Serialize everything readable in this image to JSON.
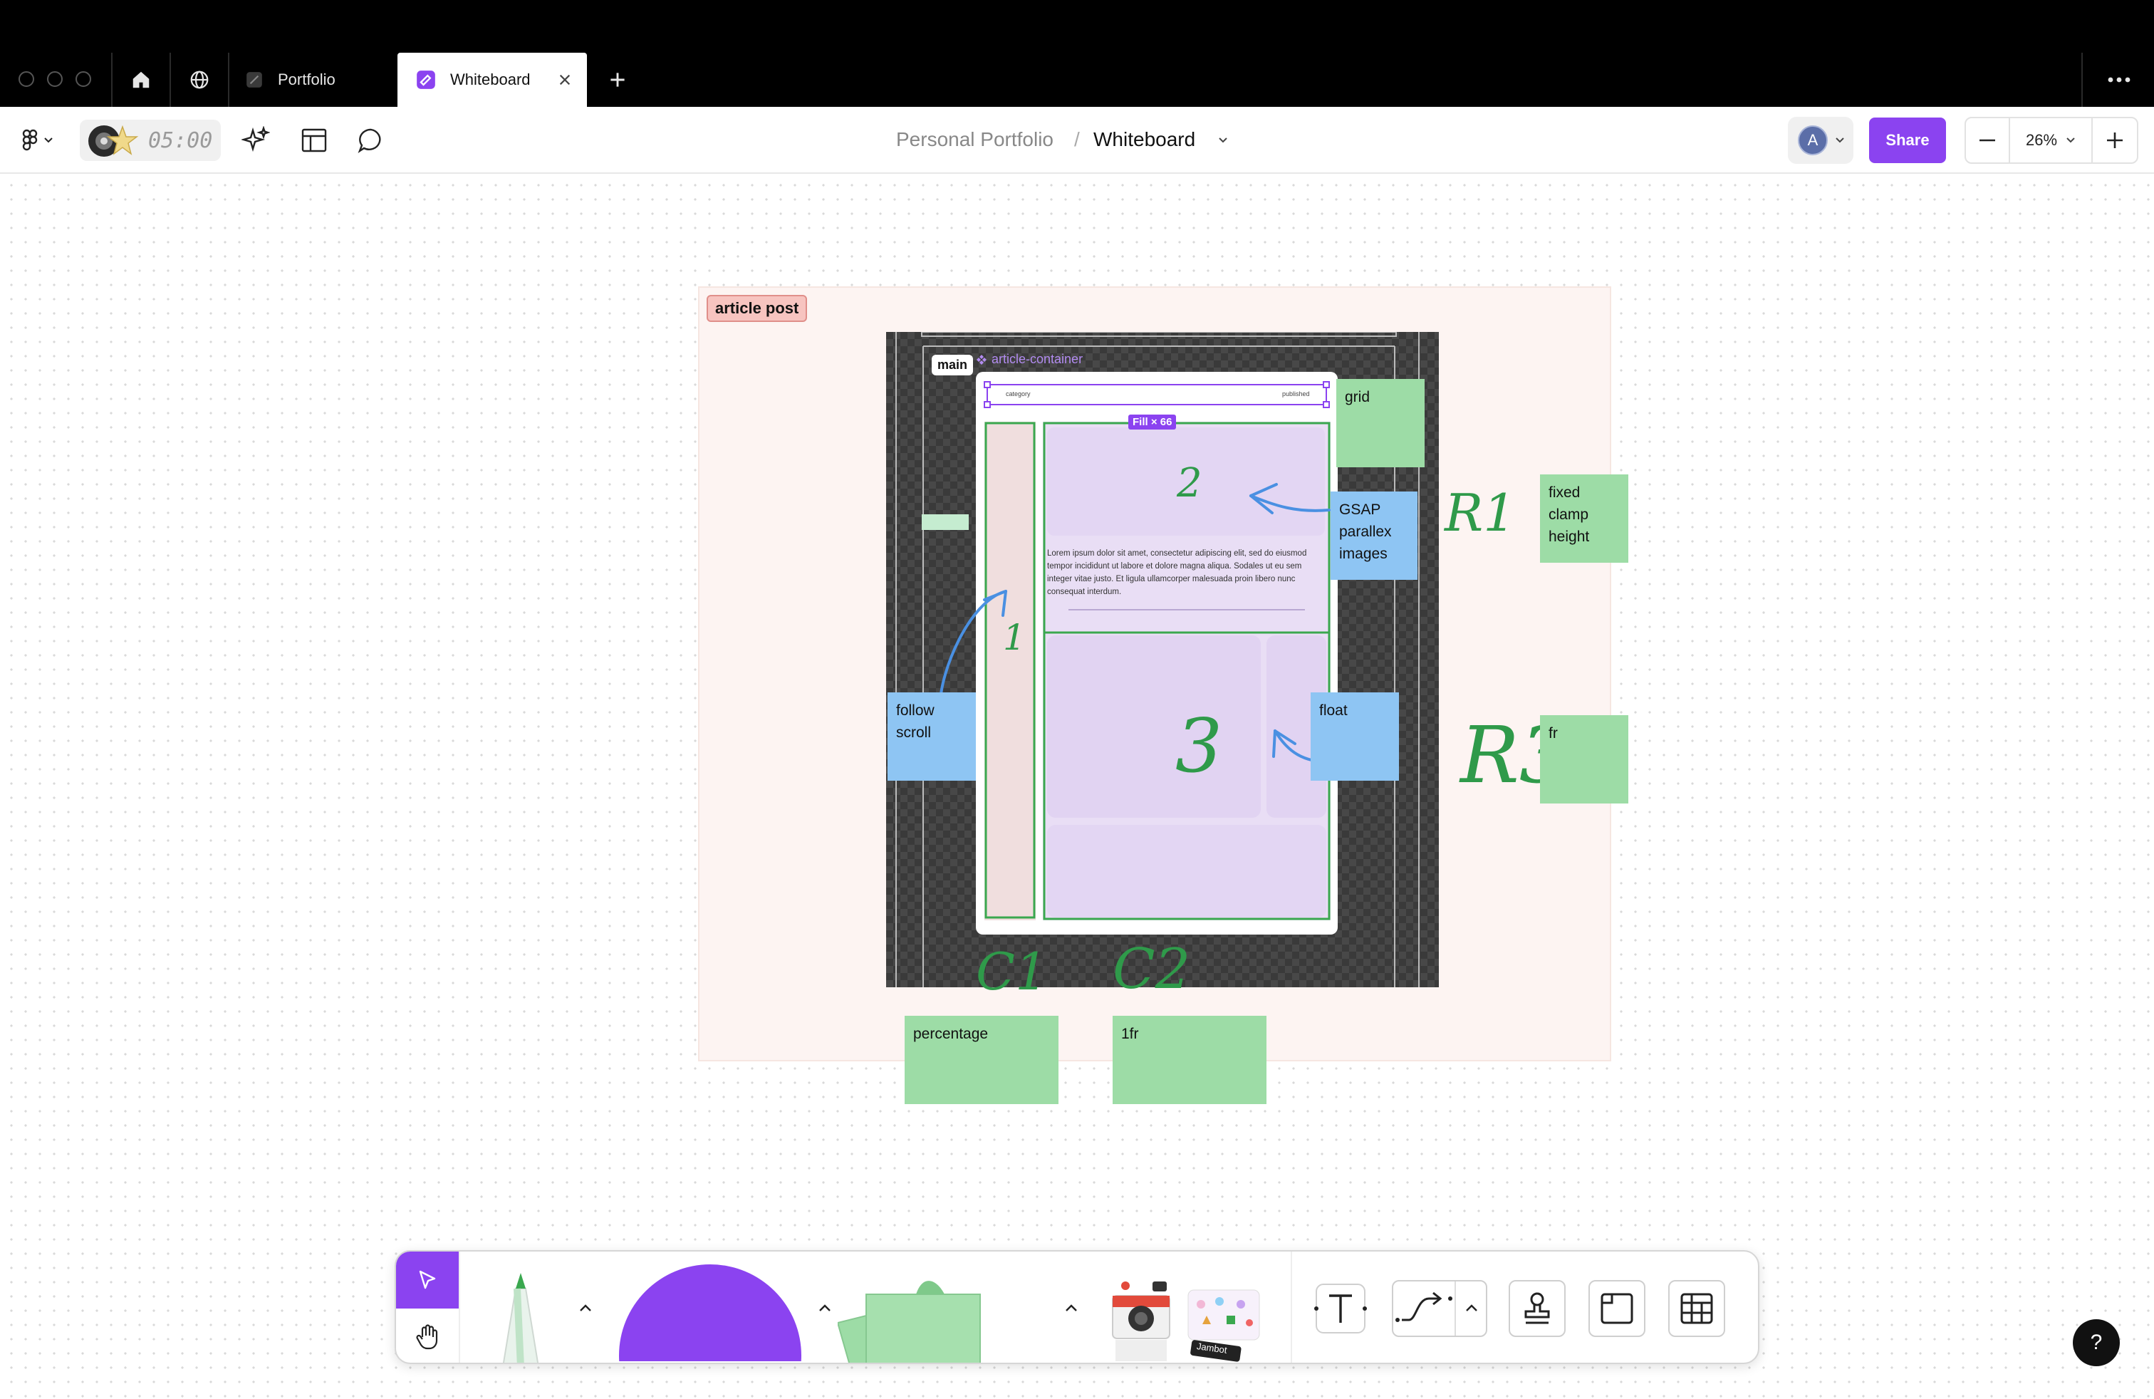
{
  "tabs": [
    {
      "label": "Portfolio"
    },
    {
      "label": "Whiteboard"
    }
  ],
  "toolbar": {
    "timer": "05:00",
    "breadcrumb": {
      "project": "Personal Portfolio",
      "separator": "/",
      "file": "Whiteboard"
    },
    "avatar": "A",
    "share_label": "Share",
    "zoom": "26%"
  },
  "canvas": {
    "section_label": "article post",
    "frame": {
      "main_tag": "main",
      "component_label": "article-container",
      "header_left": "category",
      "header_right": "published",
      "fill_badge": "Fill × 66",
      "body_text": "Lorem ipsum dolor sit amet, consectetur adipiscing elit, sed do eiusmod tempor incididunt ut labore et dolore magna aliqua. Sodales ut eu sem integer vitae justo. Et ligula ullamcorper malesuada proin libero nunc consequat interdum."
    },
    "handwriting": {
      "n1": "1",
      "n2": "2",
      "n3": "3",
      "r1": "R1",
      "r3": "R3",
      "c1": "C1",
      "c2": "C2"
    },
    "stickies": {
      "grid": "grid",
      "gsap": "GSAP\nparallex\nimages",
      "follow_scroll": "follow\nscroll",
      "float": "float",
      "fixed_clamp": "fixed\nclamp\nheight",
      "fr": "fr",
      "percentage": "percentage",
      "one_fr": "1fr"
    }
  },
  "bottom_toolbar": {
    "sticker_label": "Jambot"
  },
  "help_label": "?",
  "colors": {
    "accent": "#8b43f0",
    "sticky_green": "#9ddca6",
    "sticky_blue": "#8ec5f3",
    "handwriting_green": "#2f9a4a",
    "arrow_blue": "#4a90e2"
  }
}
